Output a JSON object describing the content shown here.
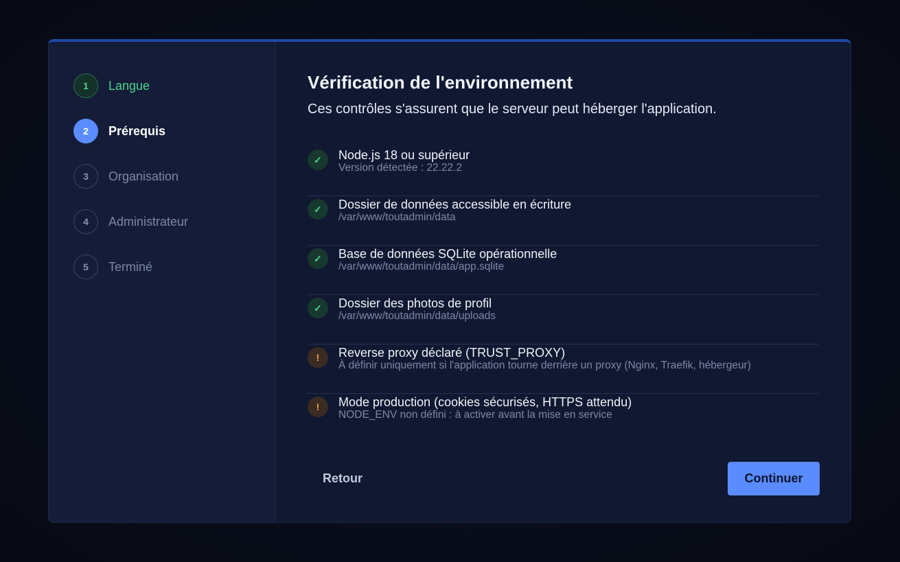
{
  "steps": [
    {
      "number": "1",
      "label": "Langue",
      "state": "done"
    },
    {
      "number": "2",
      "label": "Prérequis",
      "state": "active"
    },
    {
      "number": "3",
      "label": "Organisation",
      "state": "pending"
    },
    {
      "number": "4",
      "label": "Administrateur",
      "state": "pending"
    },
    {
      "number": "5",
      "label": "Terminé",
      "state": "pending"
    }
  ],
  "main": {
    "title": "Vérification de l'environnement",
    "subtitle": "Ces contrôles s'assurent que le serveur peut héberger l'application."
  },
  "checks": [
    {
      "status": "ok",
      "icon": "✓",
      "title": "Node.js 18 ou supérieur",
      "detail": "Version détectée : 22.22.2"
    },
    {
      "status": "ok",
      "icon": "✓",
      "title": "Dossier de données accessible en écriture",
      "detail": "/var/www/toutadmin/data"
    },
    {
      "status": "ok",
      "icon": "✓",
      "title": "Base de données SQLite opérationnelle",
      "detail": "/var/www/toutadmin/data/app.sqlite"
    },
    {
      "status": "ok",
      "icon": "✓",
      "title": "Dossier des photos de profil",
      "detail": "/var/www/toutadmin/data/uploads"
    },
    {
      "status": "warn",
      "icon": "!",
      "title": "Reverse proxy déclaré (TRUST_PROXY)",
      "detail": "À définir uniquement si l'application tourne derrière un proxy (Nginx, Traefik, hébergeur)"
    },
    {
      "status": "warn",
      "icon": "!",
      "title": "Mode production (cookies sécurisés, HTTPS attendu)",
      "detail": "NODE_ENV non défini : à activer avant la mise en service"
    }
  ],
  "actions": {
    "back_label": "Retour",
    "next_label": "Continuer"
  },
  "colors": {
    "accent": "#5b8cff",
    "success": "#4bd38a",
    "warning": "#f5a04a",
    "card_top_border": "#1d4aa8"
  }
}
